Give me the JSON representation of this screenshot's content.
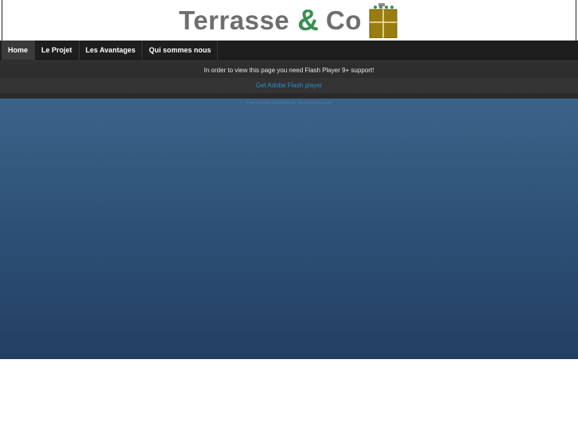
{
  "header": {
    "logo": {
      "word1": "Terrasse",
      "ampersand": "&",
      "word2": "Co",
      "mark_icon": "gate-box-icon"
    }
  },
  "nav": {
    "items": [
      {
        "label": "Home",
        "active": true
      },
      {
        "label": "Le Projet",
        "active": false
      },
      {
        "label": "Les Avantages",
        "active": false
      },
      {
        "label": "Qui sommes nous",
        "active": false
      }
    ]
  },
  "notice": {
    "message": "In order to view this page you need Flash Player 9+ support!",
    "link_label": "Get Adobe Flash player"
  },
  "content": {
    "credit": "Free Joomla Templates by JoomlaShine.com"
  },
  "colors": {
    "logo_grey": "#6e6e6e",
    "logo_green": "#3a8f52",
    "nav_bg": "#1e1e1e",
    "link_blue": "#2a8fc9",
    "content_blue": "#2e5278"
  }
}
